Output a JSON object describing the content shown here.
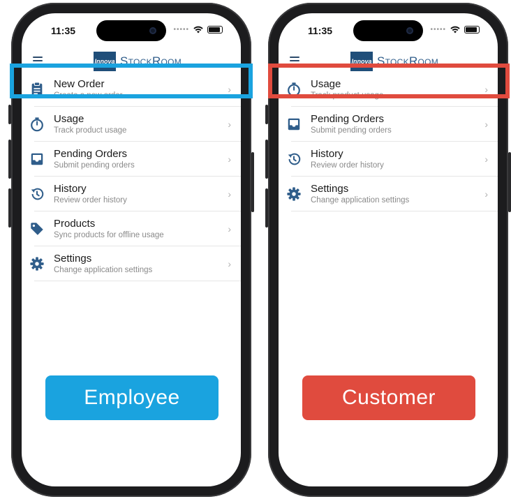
{
  "status_time": "11:35",
  "app_name": "StockRoom",
  "logo_mark": "Innova",
  "icon_color": "#2f5d8a",
  "employee": {
    "label": "Employee",
    "color": "#1aa3df",
    "menu": [
      {
        "title": "New Order",
        "subtitle": "Create a new order",
        "icon": "clipboard-icon"
      },
      {
        "title": "Usage",
        "subtitle": "Track product usage",
        "icon": "timer-icon"
      },
      {
        "title": "Pending Orders",
        "subtitle": "Submit pending orders",
        "icon": "inbox-icon"
      },
      {
        "title": "History",
        "subtitle": "Review order history",
        "icon": "history-icon"
      },
      {
        "title": "Products",
        "subtitle": "Sync products for offline usage",
        "icon": "tag-icon"
      },
      {
        "title": "Settings",
        "subtitle": "Change application settings",
        "icon": "gear-icon"
      }
    ]
  },
  "customer": {
    "label": "Customer",
    "color": "#e04b3e",
    "menu": [
      {
        "title": "Usage",
        "subtitle": "Track product usage",
        "icon": "timer-icon"
      },
      {
        "title": "Pending Orders",
        "subtitle": "Submit pending orders",
        "icon": "inbox-icon"
      },
      {
        "title": "History",
        "subtitle": "Review order history",
        "icon": "history-icon"
      },
      {
        "title": "Settings",
        "subtitle": "Change application settings",
        "icon": "gear-icon"
      }
    ]
  }
}
